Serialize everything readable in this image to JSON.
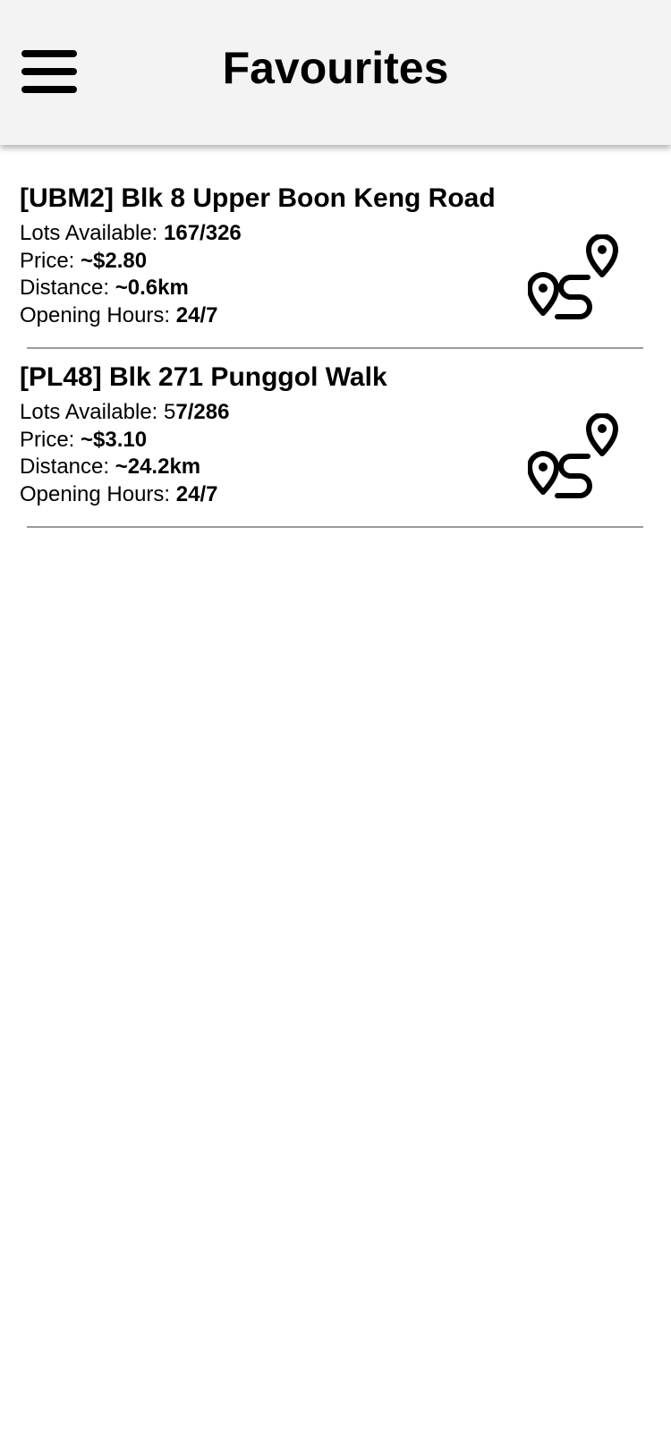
{
  "header": {
    "title": "Favourites",
    "menu_icon": "hamburger-menu-icon"
  },
  "favourites": [
    {
      "name": "[UBM2] Blk 8 Upper Boon Keng Road",
      "lots_label": "Lots Available: ",
      "lots_value": "167/326",
      "price_label": "Price: ",
      "price_value": "~$2.80",
      "distance_label": "Distance: ",
      "distance_value": "~0.6km",
      "hours_label": "Opening Hours: ",
      "hours_value": "24/7",
      "action_icon": "route-directions-icon"
    },
    {
      "name": "[PL48] Blk 271 Punggol Walk",
      "lots_label": "Lots Available: 5",
      "lots_value": "7/286",
      "price_label": "Price: ",
      "price_value": "~$3.10",
      "distance_label": "Distance: ",
      "distance_value": "~24.2km",
      "hours_label": "Opening Hours: ",
      "hours_value": "24/7",
      "action_icon": "route-directions-icon"
    }
  ]
}
